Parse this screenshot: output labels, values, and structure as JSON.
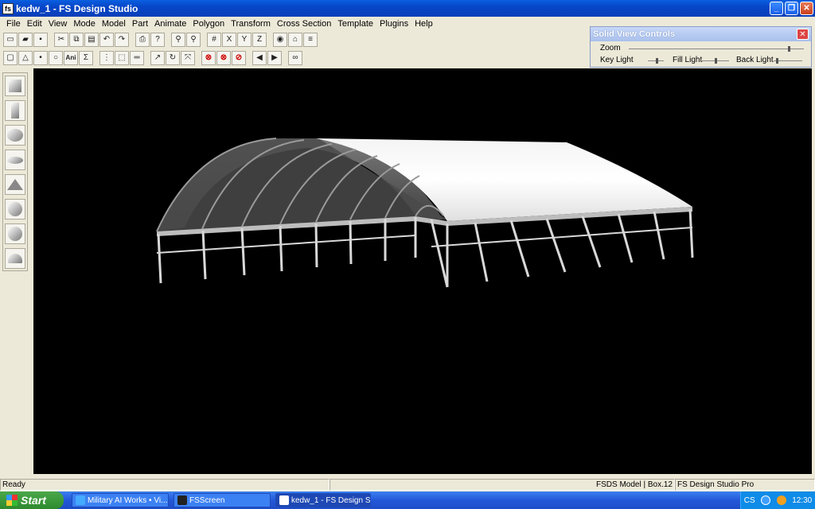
{
  "window": {
    "title": "kedw_1 - FS Design Studio",
    "icon_label": "fs"
  },
  "menu": [
    "File",
    "Edit",
    "View",
    "Mode",
    "Model",
    "Part",
    "Animate",
    "Polygon",
    "Transform",
    "Cross Section",
    "Template",
    "Plugins",
    "Help"
  ],
  "toolbar": {
    "ani_label": "Ani"
  },
  "solid_view_controls": {
    "title": "Solid View Controls",
    "zoom_label": "Zoom",
    "key_light_label": "Key Light",
    "fill_light_label": "Fill Light",
    "back_light_label": "Back Light",
    "zoom_level": 0.92,
    "key_light_level": 0.6,
    "fill_light_level": 0.5,
    "back_light_level": 0.1
  },
  "status": {
    "left": "Ready",
    "model": "FSDS Model | Box.12",
    "product": "FS Design Studio Pro"
  },
  "taskbar": {
    "start_label": "Start",
    "tasks": [
      "Military AI Works • Vi...",
      "FSScreen",
      "kedw_1 - FS Design S..."
    ],
    "tray_lang": "CS",
    "clock": "12:30"
  },
  "colors": {
    "viewport_bg": "#000000",
    "titlebar": "#0646c8",
    "taskbar": "#2458d8"
  }
}
